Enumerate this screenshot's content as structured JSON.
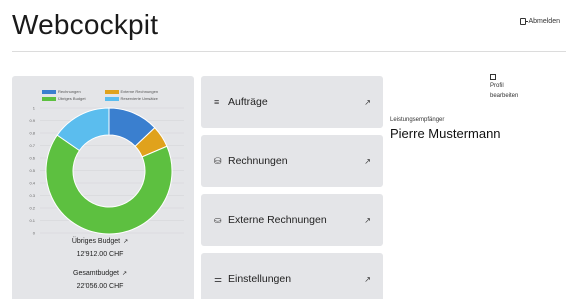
{
  "header": {
    "title": "Webcockpit",
    "logout_label": "Abmelden"
  },
  "chart_data": {
    "type": "pie",
    "variant": "donut",
    "legend": [
      "Rechnungen",
      "Externe Rechnungen",
      "Übriges Budget",
      "Reservierte Umsätze"
    ],
    "series": [
      {
        "name": "Rechnungen",
        "value": 2530,
        "color": "#3a7fcf"
      },
      {
        "name": "Externe Rechnungen",
        "value": 1100,
        "color": "#e0a21c"
      },
      {
        "name": "Übriges Budget",
        "value": 12912,
        "color": "#5dc040"
      },
      {
        "name": "Reservierte Umsätze",
        "value": 3000,
        "color": "#5bbdee"
      }
    ],
    "ylim": [
      0,
      1
    ],
    "yticks": [
      "0",
      "0.1",
      "0.2",
      "0.3",
      "0.4",
      "0.5",
      "0.6",
      "0.7",
      "0.8",
      "0.9",
      "1"
    ],
    "legend_position": "top"
  },
  "budgets": {
    "remaining_label": "Übriges Budget",
    "remaining_value": "12'912.00 CHF",
    "total_label": "Gesamtbudget",
    "total_value": "22'056.00 CHF"
  },
  "nav": {
    "items": [
      {
        "label": "Aufträge",
        "icon": "list-icon"
      },
      {
        "label": "Rechnungen",
        "icon": "coins-icon"
      },
      {
        "label": "Externe Rechnungen",
        "icon": "database-icon"
      },
      {
        "label": "Einstellungen",
        "icon": "sliders-icon"
      }
    ],
    "arrow": "↗"
  },
  "profile": {
    "edit_label_1": "Profil",
    "edit_label_2": "bearbeiten",
    "recipient_label": "Leistungsempfänger",
    "recipient_name": "Pierre Mustermann"
  }
}
